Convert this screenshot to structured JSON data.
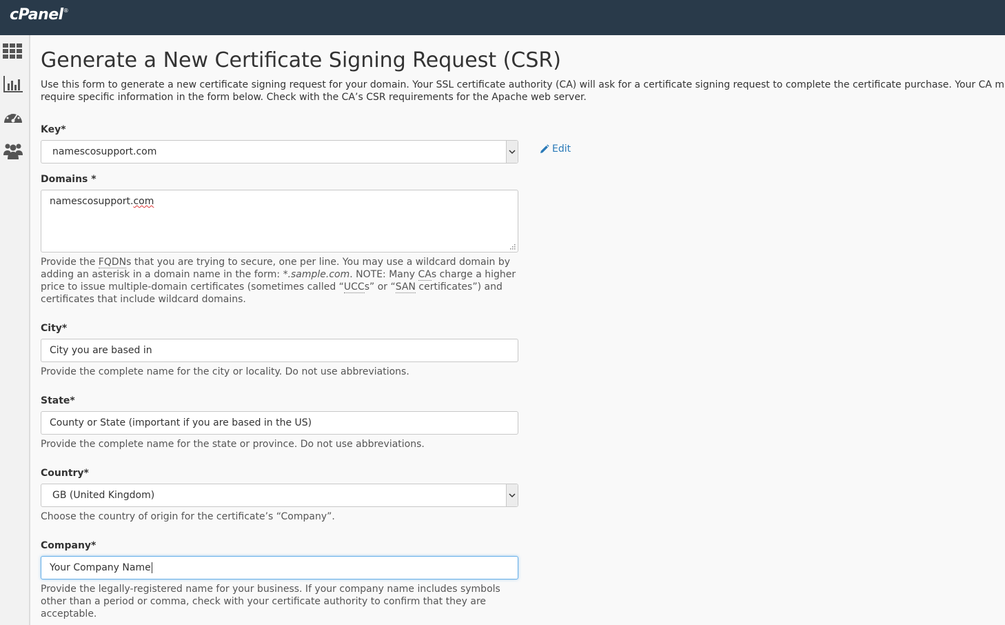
{
  "brand": {
    "logo_text": "cPanel",
    "trademark": "®"
  },
  "sidebar": {
    "items": [
      {
        "icon": "grid-icon"
      },
      {
        "icon": "bar-chart-icon"
      },
      {
        "icon": "dashboard-gauge-icon"
      },
      {
        "icon": "users-icon"
      }
    ]
  },
  "page": {
    "title": "Generate a New Certificate Signing Request (CSR)",
    "intro": "Use this form to generate a new certificate signing request for your domain. Your SSL certificate authority (CA) will ask for a certificate signing request to complete the certificate purchase. Your CA may require specific information in the form below. Check with the CA’s CSR requirements for the Apache web server."
  },
  "form": {
    "key": {
      "label": "Key*",
      "value": "namescosupport.com",
      "edit_label": "Edit"
    },
    "domains": {
      "label": "Domains *",
      "value_prefix": "namescosupport.",
      "value_suffix": "com",
      "help": {
        "p1": "Provide the ",
        "fqdn": "FQDN",
        "p2": "s that you are trying to secure, one per line. You may use a wildcard domain by adding an asterisk in a domain name in the form: ",
        "example": "*.sample.com",
        "p3": ". NOTE: Many ",
        "ca": "CA",
        "p4": "s charge a higher price to issue multiple-domain certificates (sometimes called “",
        "ucc": "UCC",
        "p5": "s” or “",
        "san": "SAN",
        "p6": " certificates”) and certificates that include wildcard domains."
      }
    },
    "city": {
      "label": "City*",
      "placeholder": "City you are based in",
      "help": "Provide the complete name for the city or locality. Do not use abbreviations."
    },
    "state": {
      "label": "State*",
      "placeholder": "County or State (important if you are based in the US)",
      "help": "Provide the complete name for the state or province. Do not use abbreviations."
    },
    "country": {
      "label": "Country*",
      "value": "GB (United Kingdom)",
      "help": "Choose the country of origin for the certificate’s “Company”."
    },
    "company": {
      "label": "Company*",
      "value": "Your Company Name",
      "help": "Provide the legally-registered name for your business. If your company name includes symbols other than a period or comma, check with your certificate authority to confirm that they are acceptable."
    }
  },
  "colors": {
    "topbar": "#293a4a",
    "link": "#2a7ab8",
    "focus": "#66afe9"
  }
}
